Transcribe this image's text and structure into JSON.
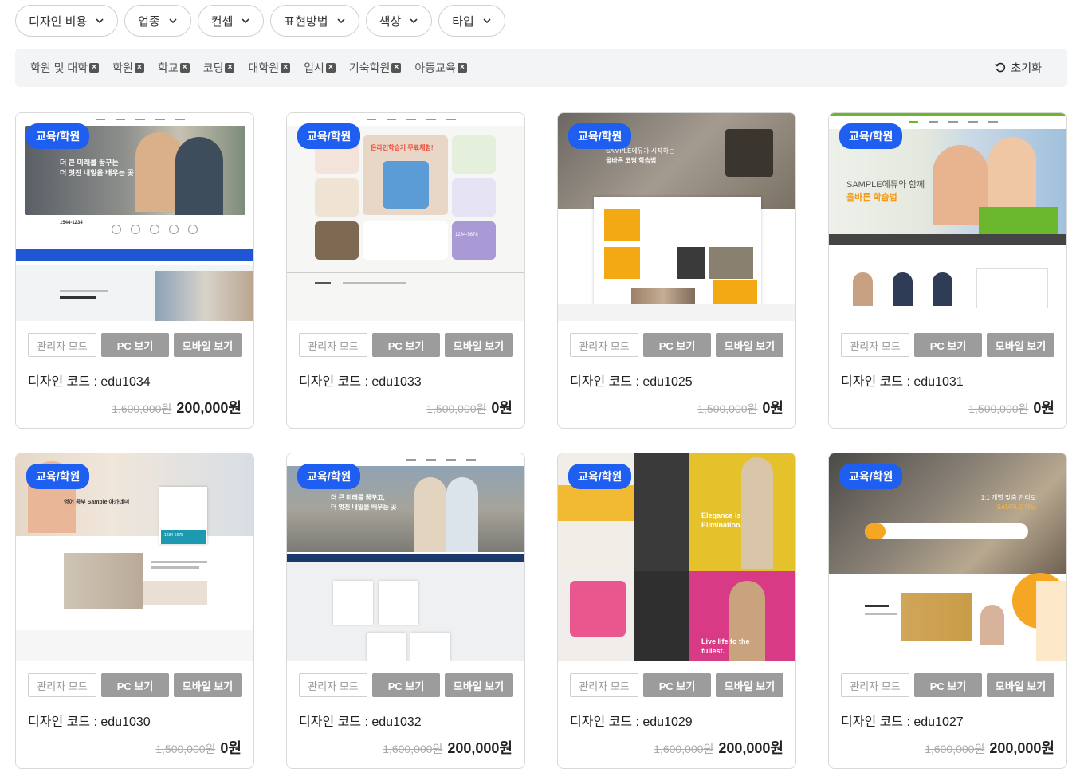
{
  "filters": [
    {
      "label": "디자인 비용"
    },
    {
      "label": "업종"
    },
    {
      "label": "컨셉"
    },
    {
      "label": "표현방법"
    },
    {
      "label": "색상"
    },
    {
      "label": "타입"
    }
  ],
  "tags": [
    {
      "label": "학원 및 대학"
    },
    {
      "label": "학원"
    },
    {
      "label": "학교"
    },
    {
      "label": "코딩"
    },
    {
      "label": "대학원"
    },
    {
      "label": "입시"
    },
    {
      "label": "기숙학원"
    },
    {
      "label": "아동교육"
    }
  ],
  "reset_label": "초기화",
  "buttons": {
    "admin": "관리자 모드",
    "pc": "PC 보기",
    "mobile": "모바일 보기"
  },
  "cards": [
    {
      "badge": "교육/학원",
      "code": "디자인 코드 : edu1034",
      "orig": "1,600,000원",
      "sale": "200,000원",
      "thumb_text": [
        "더 큰 미래를 꿈꾸는",
        "더 멋진 내일을 배우는 곳"
      ]
    },
    {
      "badge": "교육/학원",
      "code": "디자인 코드 : edu1033",
      "orig": "1,500,000원",
      "sale": "0원",
      "thumb_text": [
        "온라인학습기 무료체험!",
        "1234-5678"
      ]
    },
    {
      "badge": "교육/학원",
      "code": "디자인 코드 : edu1025",
      "orig": "1,500,000원",
      "sale": "0원",
      "thumb_text": [
        "SAMPLE에듀가 시작하는",
        "올바른 코딩 학습법"
      ]
    },
    {
      "badge": "교육/학원",
      "code": "디자인 코드 : edu1031",
      "orig": "1,500,000원",
      "sale": "0원",
      "thumb_text": [
        "SAMPLE에듀와 함께",
        "올바른 학습법"
      ]
    },
    {
      "badge": "교육/학원",
      "code": "디자인 코드 : edu1030",
      "orig": "1,500,000원",
      "sale": "0원",
      "thumb_text": [
        "영어 공부 Sample 아카데미",
        "1234-5678"
      ]
    },
    {
      "badge": "교육/학원",
      "code": "디자인 코드 : edu1032",
      "orig": "1,600,000원",
      "sale": "200,000원",
      "thumb_text": [
        "더 큰 미래를 꿈꾸고,",
        "더 멋진 내일을 배우는 곳"
      ]
    },
    {
      "badge": "교육/학원",
      "code": "디자인 코드 : edu1029",
      "orig": "1,600,000원",
      "sale": "200,000원",
      "thumb_text": [
        "Elegance is Elimination.",
        "Live life to the fullest."
      ]
    },
    {
      "badge": "교육/학원",
      "code": "디자인 코드 : edu1027",
      "orig": "1,600,000원",
      "sale": "200,000원",
      "thumb_text": [
        "1:1 개별 맞춤 관리로",
        "SAMPLE 에듀"
      ]
    }
  ]
}
